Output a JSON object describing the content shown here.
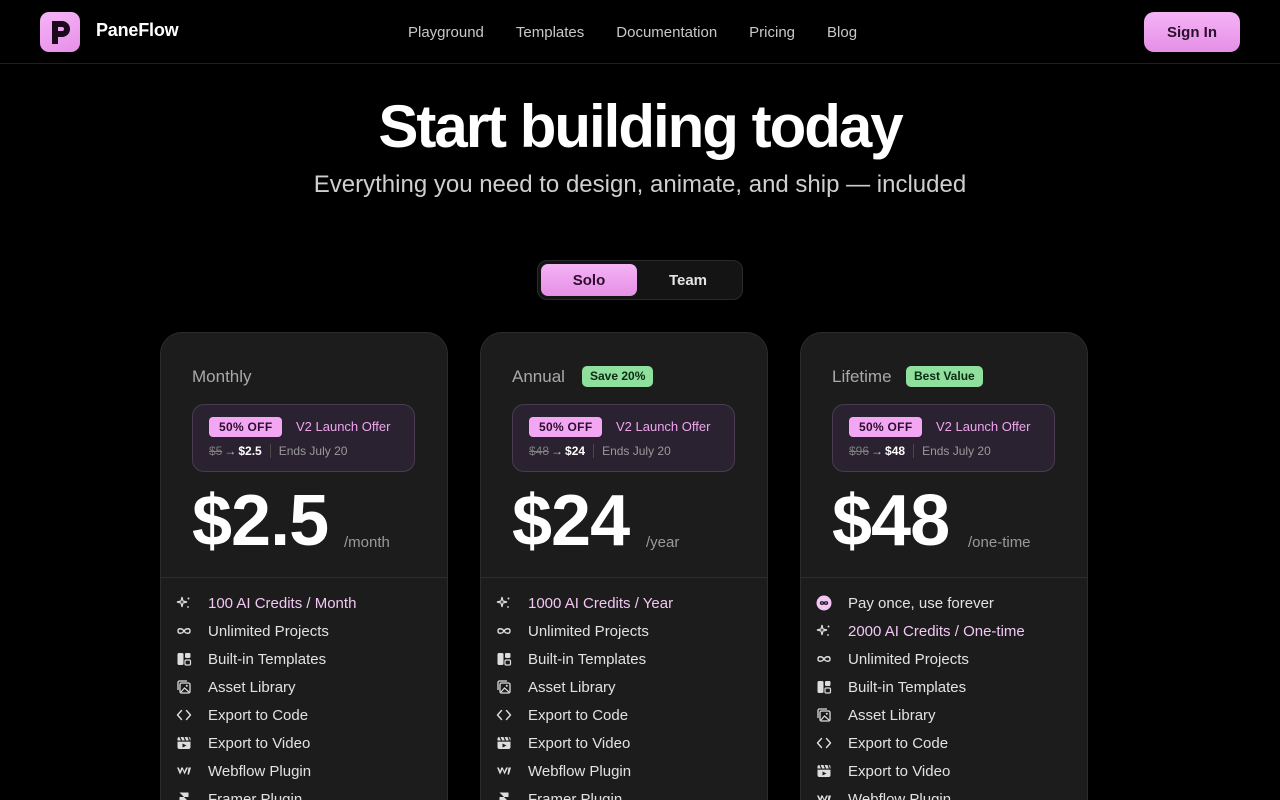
{
  "header": {
    "brand": "PaneFlow",
    "nav": [
      "Playground",
      "Templates",
      "Documentation",
      "Pricing",
      "Blog"
    ],
    "sign_in": "Sign In"
  },
  "hero": {
    "title": "Start building today",
    "subtitle": "Everything you need to design, animate, and ship — included"
  },
  "toggle": {
    "solo": "Solo",
    "team": "Team",
    "selected": "Solo"
  },
  "colors": {
    "accent": "#f3a6f3",
    "badge_green": "#8ee09c",
    "background": "#000000",
    "card": "#1c1c1d"
  },
  "plans": [
    {
      "name": "Monthly",
      "badge": "",
      "offer": {
        "pill": "50% OFF",
        "label": "V2 Launch Offer",
        "old": "$5",
        "new": "$2.5",
        "ends": "Ends July 20"
      },
      "price": "$2.5",
      "period": "/month",
      "features": [
        {
          "icon": "sparkle-icon",
          "text": "100 AI Credits / Month",
          "accent": true
        },
        {
          "icon": "infinity-icon",
          "text": "Unlimited Projects"
        },
        {
          "icon": "templates-icon",
          "text": "Built-in Templates"
        },
        {
          "icon": "image-stack-icon",
          "text": "Asset Library"
        },
        {
          "icon": "code-icon",
          "text": "Export to Code"
        },
        {
          "icon": "clapperboard-icon",
          "text": "Export to Video"
        },
        {
          "icon": "webflow-icon",
          "text": "Webflow Plugin"
        },
        {
          "icon": "framer-icon",
          "text": "Framer Plugin"
        }
      ]
    },
    {
      "name": "Annual",
      "badge": "Save 20%",
      "offer": {
        "pill": "50% OFF",
        "label": "V2 Launch Offer",
        "old": "$48",
        "new": "$24",
        "ends": "Ends July 20"
      },
      "price": "$24",
      "period": "/year",
      "features": [
        {
          "icon": "sparkle-icon",
          "text": "1000 AI Credits / Year",
          "accent": true
        },
        {
          "icon": "infinity-icon",
          "text": "Unlimited Projects"
        },
        {
          "icon": "templates-icon",
          "text": "Built-in Templates"
        },
        {
          "icon": "image-stack-icon",
          "text": "Asset Library"
        },
        {
          "icon": "code-icon",
          "text": "Export to Code"
        },
        {
          "icon": "clapperboard-icon",
          "text": "Export to Video"
        },
        {
          "icon": "webflow-icon",
          "text": "Webflow Plugin"
        },
        {
          "icon": "framer-icon",
          "text": "Framer Plugin"
        }
      ]
    },
    {
      "name": "Lifetime",
      "badge": "Best Value",
      "offer": {
        "pill": "50% OFF",
        "label": "V2 Launch Offer",
        "old": "$96",
        "new": "$48",
        "ends": "Ends July 20"
      },
      "price": "$48",
      "period": "/one-time",
      "features": [
        {
          "icon": "infinity-circle-icon",
          "text": "Pay once, use forever",
          "accent": false
        },
        {
          "icon": "sparkle-icon",
          "text": "2000 AI Credits / One-time",
          "accent": true
        },
        {
          "icon": "infinity-icon",
          "text": "Unlimited Projects"
        },
        {
          "icon": "templates-icon",
          "text": "Built-in Templates"
        },
        {
          "icon": "image-stack-icon",
          "text": "Asset Library"
        },
        {
          "icon": "code-icon",
          "text": "Export to Code"
        },
        {
          "icon": "clapperboard-icon",
          "text": "Export to Video"
        },
        {
          "icon": "webflow-icon",
          "text": "Webflow Plugin"
        }
      ]
    }
  ]
}
